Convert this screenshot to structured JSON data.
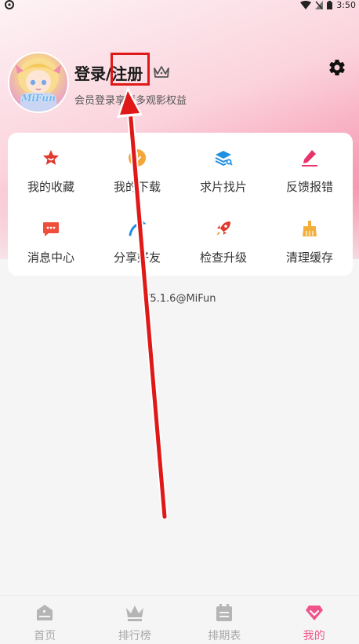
{
  "status_bar": {
    "time": "3:50"
  },
  "profile": {
    "avatar_caption": "MiFun",
    "login_label": "登录/注册",
    "subtitle": "会员登录享更多观影权益"
  },
  "menu": {
    "items": [
      {
        "label": "我的收藏",
        "icon": "star-icon",
        "color": "#e0392e"
      },
      {
        "label": "我的下载",
        "icon": "download-icon",
        "color": "#f4a63a"
      },
      {
        "label": "求片找片",
        "icon": "layers-search-icon",
        "color": "#1f8fe0"
      },
      {
        "label": "反馈报错",
        "icon": "edit-icon",
        "color": "#e8336b"
      },
      {
        "label": "消息中心",
        "icon": "message-icon",
        "color": "#f04e3a"
      },
      {
        "label": "分享好友",
        "icon": "share-icon",
        "color": "#1f8fe0"
      },
      {
        "label": "检查升级",
        "icon": "rocket-icon",
        "color": "#e0392e"
      },
      {
        "label": "清理缓存",
        "icon": "broom-icon",
        "color": "#f2b03a"
      }
    ]
  },
  "version": "V5.1.6@MiFun",
  "nav": {
    "items": [
      {
        "label": "首页",
        "icon": "home-icon",
        "active": false
      },
      {
        "label": "排行榜",
        "icon": "crown-icon",
        "active": false
      },
      {
        "label": "排期表",
        "icon": "calendar-icon",
        "active": false
      },
      {
        "label": "我的",
        "icon": "diamond-icon",
        "active": true
      }
    ],
    "active_color": "#f0548a",
    "inactive_color": "#b5b5b5"
  },
  "annotation": {
    "box_color": "#e01818",
    "arrow_color": "#e01818"
  }
}
